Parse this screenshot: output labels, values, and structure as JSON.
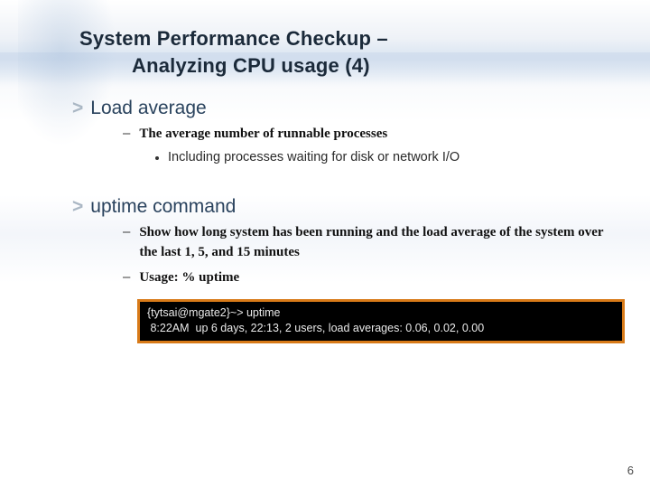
{
  "title": {
    "line1": "System Performance Checkup –",
    "line2": "Analyzing CPU usage (4)"
  },
  "sections": [
    {
      "heading": "Load average",
      "subs": [
        {
          "text": "The average number of runnable processes",
          "children": [
            {
              "text": "Including processes waiting for disk or network I/O"
            }
          ]
        }
      ]
    },
    {
      "heading": "uptime command",
      "subs": [
        {
          "text": "Show how long system has been running and the load average of the system over the last 1, 5, and 15 minutes"
        },
        {
          "text": "Usage: % uptime"
        }
      ]
    }
  ],
  "codebox": {
    "line1": "{tytsai@mgate2}~> uptime",
    "line2": " 8:22AM  up 6 days, 22:13, 2 users, load averages: 0.06, 0.02, 0.00"
  },
  "bullets": {
    "arrow": ">",
    "dash": "–"
  },
  "pageNumber": "6"
}
